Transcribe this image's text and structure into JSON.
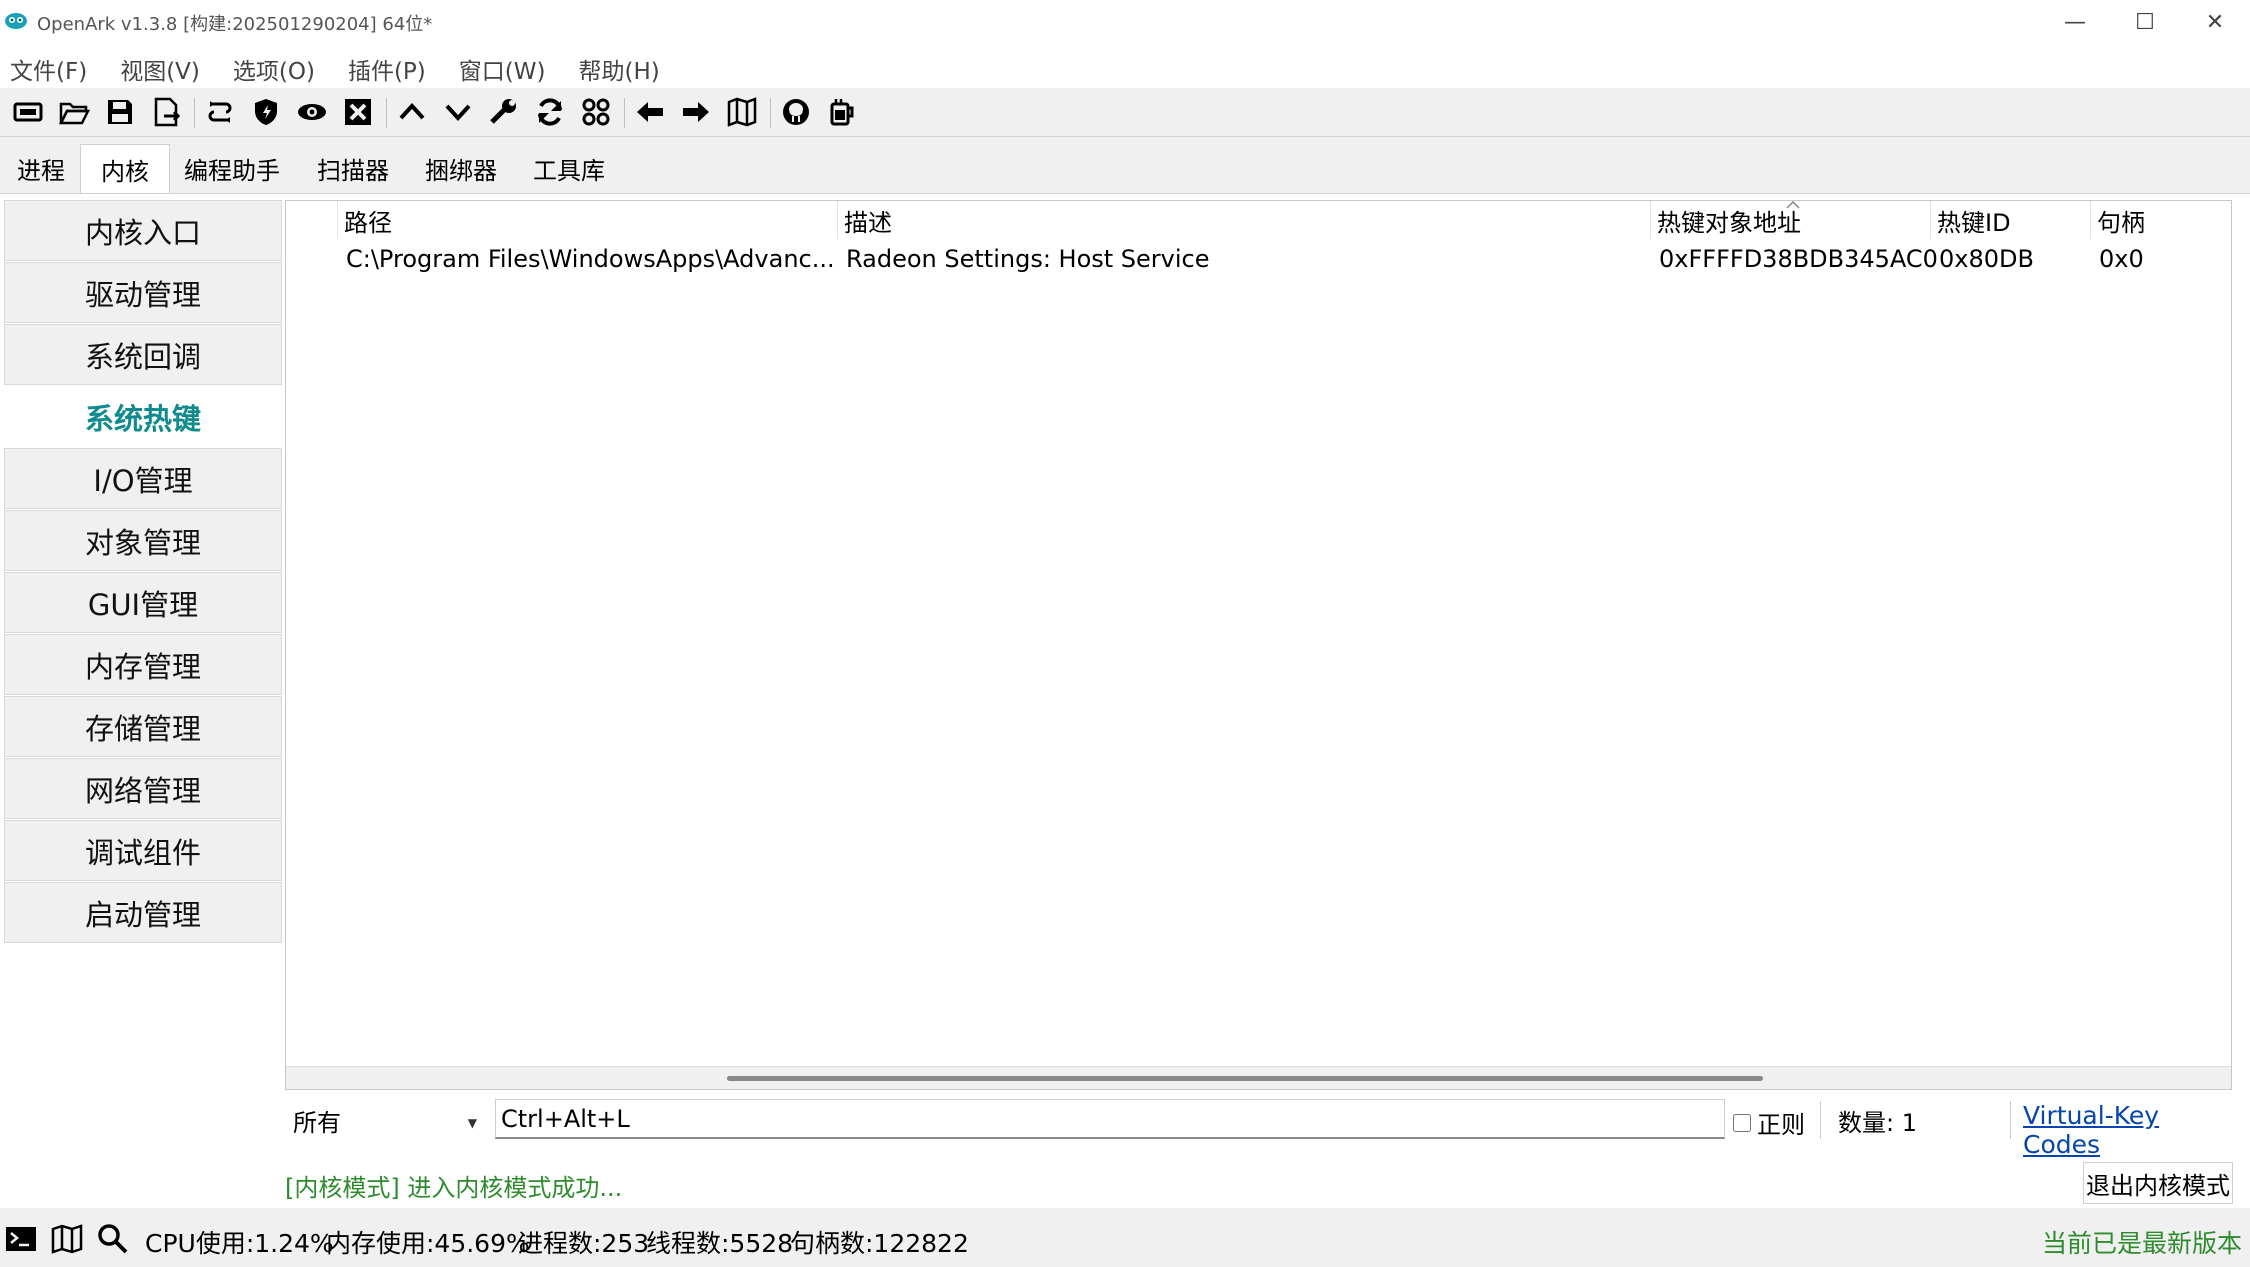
{
  "window": {
    "title": "OpenArk v1.3.8 [构建:202501290204]  64位*",
    "controls": {
      "minimize": "—",
      "maximize": "☐",
      "close": "✕"
    }
  },
  "menu": [
    "文件(F)",
    "视图(V)",
    "选项(O)",
    "插件(P)",
    "窗口(W)",
    "帮助(H)"
  ],
  "toolbar_icons": [
    "console-icon",
    "open-folder-icon",
    "save-icon",
    "export-icon",
    "refresh-link-icon",
    "shield-icon",
    "eye-icon",
    "close-box-icon",
    "arrow-up-icon",
    "arrow-down-icon",
    "wrench-icon",
    "sync-icon",
    "grid-icon",
    "arrow-left-icon",
    "arrow-right-icon",
    "map-icon",
    "github-icon",
    "coffee-icon"
  ],
  "tabs": [
    "进程",
    "内核",
    "编程助手",
    "扫描器",
    "捆绑器",
    "工具库"
  ],
  "active_tab": "内核",
  "sidebar": [
    "内核入口",
    "驱动管理",
    "系统回调",
    "系统热键",
    "I/O管理",
    "对象管理",
    "GUI管理",
    "内存管理",
    "存储管理",
    "网络管理",
    "调试组件",
    "启动管理"
  ],
  "active_sidebar": "系统热键",
  "table": {
    "columns": [
      "路径",
      "描述",
      "热键对象地址",
      "热键ID",
      "句柄"
    ],
    "rows": [
      [
        "C:\\Program Files\\WindowsApps\\Advanc...",
        "Radeon Settings: Host Service",
        "0xFFFFD38BDB345AC0",
        "0x80DB",
        "0x0"
      ]
    ]
  },
  "filter": {
    "scope": "所有",
    "search_value": "Ctrl+Alt+L",
    "regex_label": "正则",
    "regex_checked": false,
    "count_label": "数量: 1",
    "vk_link": "Virtual-Key Codes"
  },
  "log": {
    "message": "[内核模式] 进入内核模式成功...",
    "exit_button": "退出内核模式"
  },
  "status": {
    "cpu": "CPU使用:1.24%",
    "memory": "内存使用:45.69%",
    "processes": "进程数:253",
    "threads": "线程数:5528",
    "handles": "句柄数:122822",
    "version": "当前已是最新版本"
  },
  "colors": {
    "accent": "#0f8b8d",
    "log_green": "#2e8b2e",
    "link": "#0645ad"
  }
}
